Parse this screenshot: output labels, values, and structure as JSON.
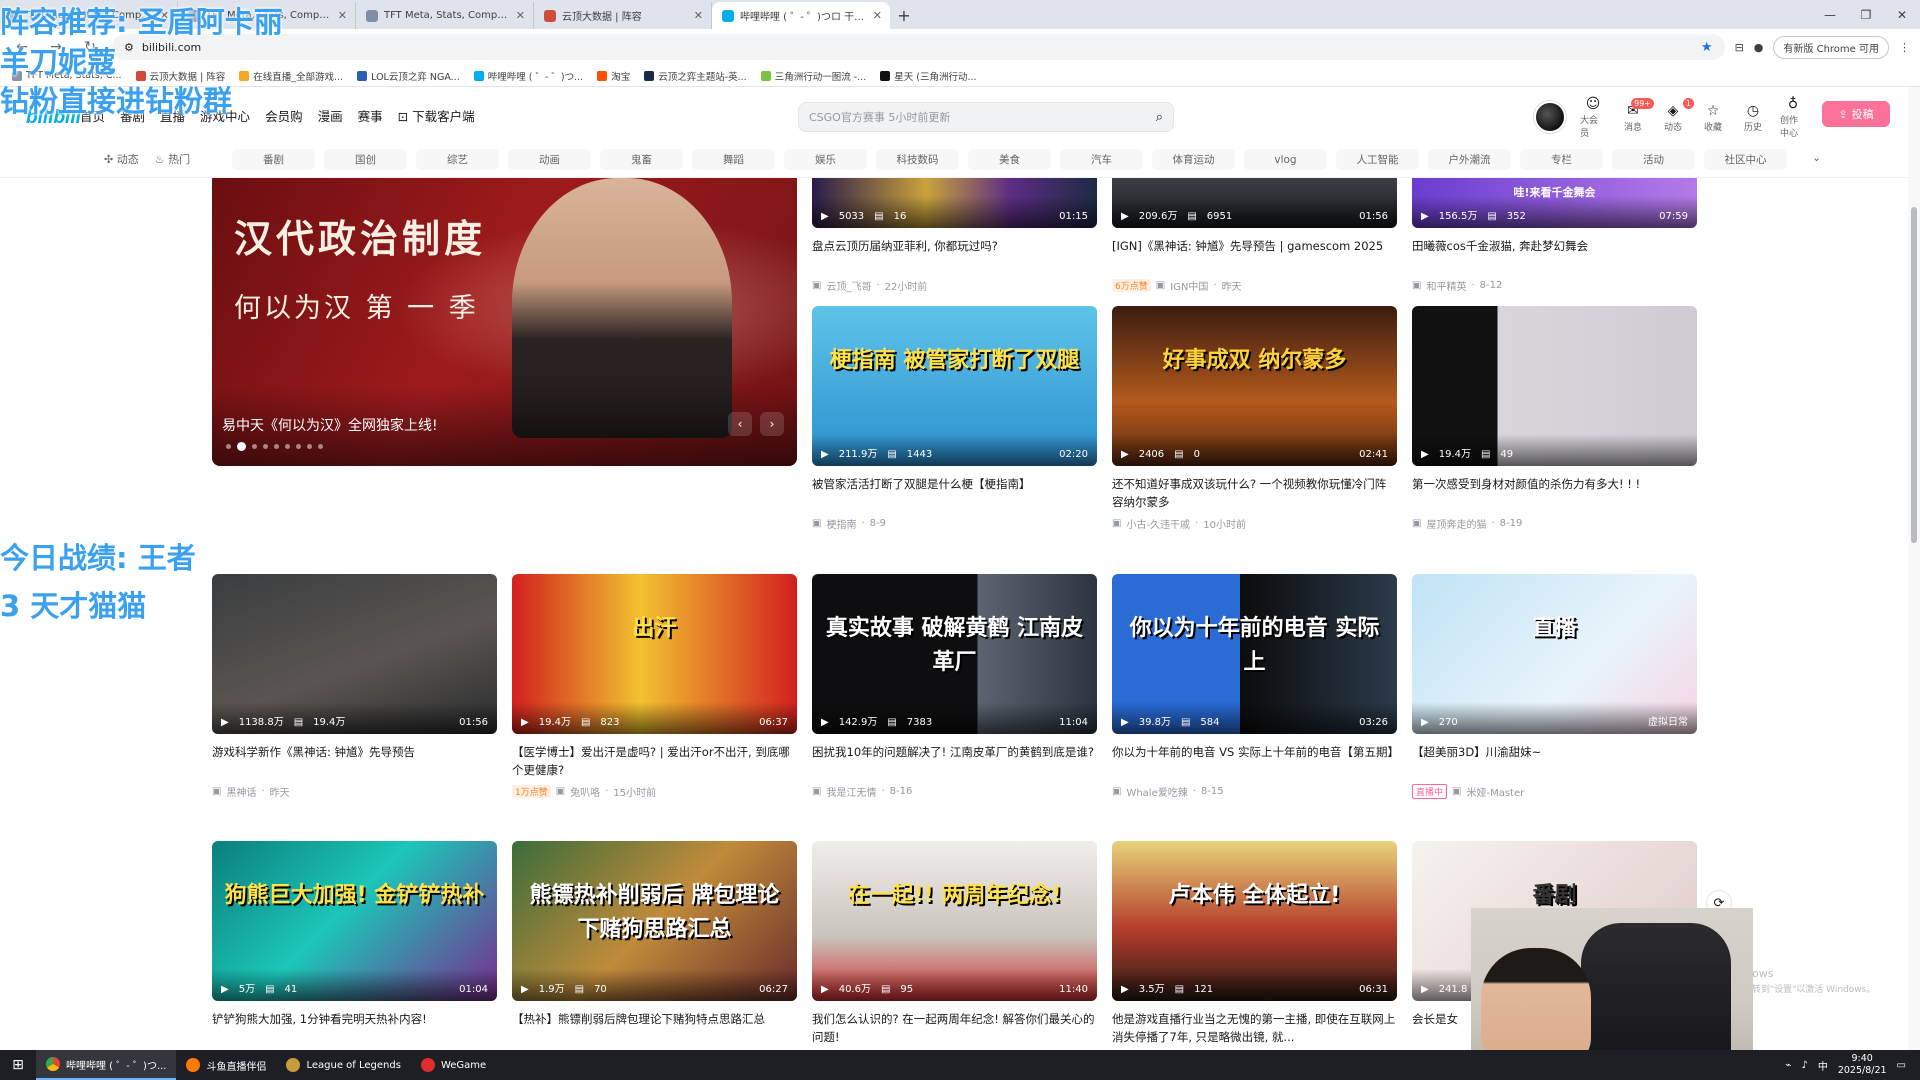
{
  "browser": {
    "tabs": [
      {
        "title": "TFT Meta, Stats, Comps, Ma",
        "active": false
      },
      {
        "title": "TFT Meta, Stats, Comps, Ma",
        "active": false
      },
      {
        "title": "TFT Meta, Stats, Comps, Ma",
        "active": false
      },
      {
        "title": "云顶大数据 | 阵容",
        "active": false
      },
      {
        "title": "哔哩哔哩 ( ゜- ゜)つロ 干杯~-bi",
        "active": true
      }
    ],
    "address": "bilibili.com",
    "new_version": "有新版 Chrome 可用",
    "bookmarks": [
      "TFT Meta, Stats, C...",
      "云顶大数据 | 阵容",
      "在线直播_全部游戏...",
      "LOL云顶之弈 NGA...",
      "哔哩哔哩 ( ゜- ゜)つ...",
      "淘宝",
      "云顶之弈主题站-英...",
      "三角洲行动一图流 -...",
      "星天 (三角洲行动..."
    ]
  },
  "header": {
    "logo": "bilibili",
    "nav": [
      "首页",
      "番剧",
      "直播",
      "游戏中心",
      "会员购",
      "漫画",
      "赛事",
      "下载客户端"
    ],
    "search_placeholder": "CSGO官方赛事 5小时前更新",
    "icons": [
      {
        "label": "大会员",
        "glyph": "☺",
        "badge": ""
      },
      {
        "label": "消息",
        "glyph": "✉",
        "badge": "99+"
      },
      {
        "label": "动态",
        "glyph": "◈",
        "badge": "1"
      },
      {
        "label": "收藏",
        "glyph": "☆",
        "badge": ""
      },
      {
        "label": "历史",
        "glyph": "◷",
        "badge": ""
      },
      {
        "label": "创作中心",
        "glyph": "♁",
        "badge": ""
      }
    ],
    "upload_label": "投稿"
  },
  "channels": {
    "left": [
      "动态",
      "热门"
    ],
    "items": [
      "番剧",
      "国创",
      "综艺",
      "动画",
      "鬼畜",
      "舞蹈",
      "娱乐",
      "科技数码",
      "美食",
      "汽车",
      "体育运动",
      "vlog",
      "人工智能",
      "户外潮流",
      "专栏",
      "活动",
      "社区中心"
    ]
  },
  "banner": {
    "headline": "汉代政治制度",
    "subline": "何以为汉  第 一 季",
    "caption": "易中天《何以为汉》全网独家上线!"
  },
  "videos": [
    {
      "title": "盘点云顶历届纳亚菲利, 你都玩过吗?",
      "views": "5033",
      "danmaku": "16",
      "duration": "01:15",
      "author": "云顶_飞哥",
      "date": "22小时前",
      "tag": "",
      "thumb_text": ""
    },
    {
      "title": "[IGN]《黑神话: 钟馗》先导预告 | gamescom 2025",
      "views": "209.6万",
      "danmaku": "6951",
      "duration": "01:56",
      "author": "IGN中国",
      "date": "昨天",
      "tag": "6万点赞",
      "thumb_text": ""
    },
    {
      "title": "田曦薇cos千金淑猫, 奔赴梦幻舞会",
      "views": "156.5万",
      "danmaku": "352",
      "duration": "07:59",
      "author": "和平精英",
      "date": "8-12",
      "tag": "",
      "thumb_text": "哇!来看千金舞会"
    },
    {
      "title": "被管家活活打断了双腿是什么梗【梗指南】",
      "views": "211.9万",
      "danmaku": "1443",
      "duration": "02:20",
      "author": "梗指南",
      "date": "8-9",
      "tag": "",
      "thumb_text": "梗指南 被管家打断了双腿"
    },
    {
      "title": "还不知道好事成双该玩什么? 一个视频教你玩懂冷门阵容纳尔蒙多",
      "views": "2406",
      "danmaku": "0",
      "duration": "02:41",
      "author": "小古-久违干戚",
      "date": "10小时前",
      "tag": "",
      "thumb_text": "好事成双 纳尔蒙多"
    },
    {
      "title": "第一次感受到身材对颜值的杀伤力有多大! ! !",
      "views": "19.4万",
      "danmaku": "49",
      "duration": "",
      "author": "屋顶奔走的猫",
      "date": "8-19",
      "tag": "",
      "thumb_text": ""
    },
    {
      "title": "游戏科学新作《黑神话: 钟馗》先导预告",
      "views": "1138.8万",
      "danmaku": "19.4万",
      "duration": "01:56",
      "author": "黑神话",
      "date": "昨天",
      "tag": "",
      "thumb_text": ""
    },
    {
      "title": "【医学博士】爱出汗是虚吗? | 爱出汗or不出汗, 到底哪个更健康?",
      "views": "19.4万",
      "danmaku": "823",
      "duration": "06:37",
      "author": "兔叭咯",
      "date": "15小时前",
      "tag": "1万点赞",
      "thumb_text": "出汗"
    },
    {
      "title": "困扰我10年的问题解决了! 江南皮革厂的黄鹤到底是谁?",
      "views": "142.9万",
      "danmaku": "7383",
      "duration": "11:04",
      "author": "我是江无情",
      "date": "8-16",
      "tag": "",
      "thumb_text": "真实故事 破解黄鹤 江南皮革厂"
    },
    {
      "title": "你以为十年前的电音 VS 实际上十年前的电音【第五期】",
      "views": "39.8万",
      "danmaku": "584",
      "duration": "03:26",
      "author": "Whale爱吃辣",
      "date": "8-15",
      "tag": "",
      "thumb_text": "你以为十年前的电音 实际上"
    },
    {
      "title": "【超美丽3D】川渝甜妹~",
      "views": "270",
      "danmaku": "",
      "duration": "虚拟日常",
      "author": "米娅-Master",
      "date": "",
      "tag": "直播中",
      "thumb_text": "直播"
    },
    {
      "title": "铲铲狗熊大加强, 1分钟看完明天热补内容!",
      "views": "5万",
      "danmaku": "41",
      "duration": "01:04",
      "author": "",
      "date": "",
      "tag": "",
      "thumb_text": "狗熊巨大加强! 金铲铲热补"
    },
    {
      "title": "【热补】熊镖削弱后牌包理论下赌狗特点思路汇总",
      "views": "1.9万",
      "danmaku": "70",
      "duration": "06:27",
      "author": "",
      "date": "",
      "tag": "",
      "thumb_text": "熊镖热补削弱后 牌包理论下赌狗思路汇总"
    },
    {
      "title": "我们怎么认识的? 在一起两周年纪念! 解答你们最关心的问题!",
      "views": "40.6万",
      "danmaku": "95",
      "duration": "11:40",
      "author": "",
      "date": "",
      "tag": "",
      "thumb_text": "在一起!! 两周年纪念!"
    },
    {
      "title": "他是游戏直播行业当之无愧的第一主播, 即使在互联网上消失停播了7年, 只是略微出镜, 就...",
      "views": "3.5万",
      "danmaku": "121",
      "duration": "06:31",
      "author": "",
      "date": "",
      "tag": "",
      "thumb_text": "卢本伟 全体起立!"
    },
    {
      "title": "会长是女",
      "views": "241.8",
      "danmaku": "",
      "duration": "",
      "author": "",
      "date": "",
      "tag": "",
      "thumb_text": "番剧"
    }
  ],
  "overlays": {
    "line1": "阵容推荐: 圣盾阿卡丽",
    "line2": "羊刀妮蔻",
    "line3": "钻粉直接进钻粉群",
    "line4": "今日战绩: 王者",
    "line5": "3 天才猫猫"
  },
  "watermark": {
    "line1": "ows",
    "line2": "转到\"设置\"以激活 Windows。"
  },
  "taskbar": {
    "items": [
      "哔哩哔哩 ( ゜- ゜)つ...",
      "斗鱼直播伴侣",
      "League of Legends",
      "WeGame"
    ],
    "time": "9:40",
    "date": "2025/8/21",
    "ime": "中"
  },
  "colors": {
    "brand_pink": "#fb7299",
    "brand_blue": "#00aeec",
    "overlay_blue": "#3aa0f0"
  }
}
